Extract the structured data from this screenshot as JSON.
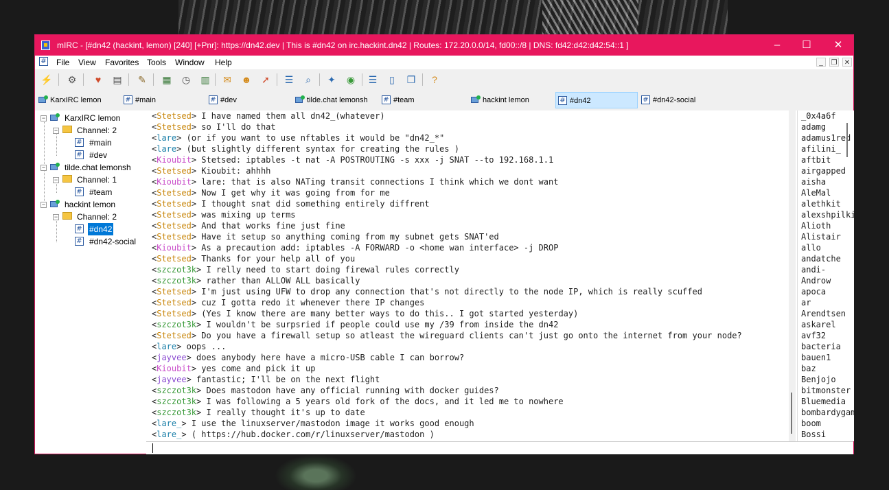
{
  "window": {
    "title": "mIRC - [#dn42 (hackint, lemon) [240] [+Pnr]: https://dn42.dev | This is #dn42 on irc.hackint.dn42 | Routes: 172.20.0.0/14, fd00::/8 | DNS: fd42:d42:d42:54::1 ]",
    "controls": {
      "minimize": "–",
      "maximize": "☐",
      "close": "✕"
    },
    "accent": "#e8175d"
  },
  "menu": {
    "items": [
      "File",
      "View",
      "Favorites",
      "Tools",
      "Window",
      "Help"
    ],
    "mdi_controls": {
      "minimize": "_",
      "restore": "❐",
      "close": "✕"
    }
  },
  "toolbar": {
    "icons": [
      "connect-icon",
      "options-icon",
      "favorites-icon",
      "address-book-icon",
      "scripts-editor-icon",
      "logs-icon",
      "dcc-icon",
      "timer-icon",
      "notify-list-icon",
      "url-list-icon",
      "channels-list-icon",
      "dcc-send-icon",
      "dcc-chat-icon",
      "received-files-icon",
      "highlights-icon",
      "tile-horizontal-icon",
      "tile-vertical-icon",
      "cascade-icon",
      "help-icon"
    ]
  },
  "switchbar": {
    "items": [
      {
        "label": "KarxIRC lemon",
        "type": "network"
      },
      {
        "label": "#main",
        "type": "channel"
      },
      {
        "label": "#dev",
        "type": "channel"
      },
      {
        "label": "tilde.chat lemonsh",
        "type": "network"
      },
      {
        "label": "#team",
        "type": "channel"
      },
      {
        "label": "hackint lemon",
        "type": "network"
      },
      {
        "label": "#dn42",
        "type": "channel",
        "active": true
      },
      {
        "label": "#dn42-social",
        "type": "channel"
      }
    ]
  },
  "tree": {
    "networks": [
      {
        "label": "KarxIRC lemon",
        "folder": "Channel: 2",
        "channels": [
          "#main",
          "#dev"
        ]
      },
      {
        "label": "tilde.chat lemonsh",
        "folder": "Channel: 1",
        "channels": [
          "#team"
        ]
      },
      {
        "label": "hackint lemon",
        "folder": "Channel: 2",
        "channels": [
          "#dn42",
          "#dn42-social"
        ]
      }
    ],
    "selected": "#dn42"
  },
  "nick_colors": {
    "Stetsed": "#c8860a",
    "lare": "#1a7fa8",
    "Kioubit": "#c94cc9",
    "szczot3k": "#3a9a3a",
    "jayvee": "#8a4ad0",
    "lare_": "#1a7fa8"
  },
  "messages": [
    {
      "nick": "Stetsed",
      "text": "I have named them all dn42_(whatever)"
    },
    {
      "nick": "Stetsed",
      "text": "so I'll do that"
    },
    {
      "nick": "lare",
      "text": "(or if you want to use nftables it would be \"dn42_*\""
    },
    {
      "nick": "lare",
      "text": "(but slightly different syntax for creating the rules )"
    },
    {
      "nick": "Kioubit",
      "text": "Stetsed: iptables -t nat -A POSTROUTING -s xxx -j SNAT --to 192.168.1.1"
    },
    {
      "nick": "Stetsed",
      "text": "Kioubit: ahhhh"
    },
    {
      "nick": "Kioubit",
      "text": "lare: that is also NATing transit connections I think which we dont want"
    },
    {
      "nick": "Stetsed",
      "text": "Now I get why it was going from for me"
    },
    {
      "nick": "Stetsed",
      "text": "I thought snat did something entirely diffrent"
    },
    {
      "nick": "Stetsed",
      "text": "was mixing up terms"
    },
    {
      "nick": "Stetsed",
      "text": "And that works fine just fine"
    },
    {
      "nick": "Stetsed",
      "text": "Have it setup so anything coming from my subnet gets SNAT'ed"
    },
    {
      "nick": "Kioubit",
      "text": "As a precaution add: iptables -A FORWARD -o <home wan interface> -j DROP"
    },
    {
      "nick": "Stetsed",
      "text": "Thanks for your help all of you"
    },
    {
      "nick": "szczot3k",
      "text": "I relly need to start doing firewal rules correctly"
    },
    {
      "nick": "szczot3k",
      "text": "rather than ALLOW ALL basically"
    },
    {
      "nick": "Stetsed",
      "text": "I'm just using UFW to drop any connection that's not directly to the node IP, which is really scuffed"
    },
    {
      "nick": "Stetsed",
      "text": "cuz I gotta redo it whenever there IP changes"
    },
    {
      "nick": "Stetsed",
      "text": "(Yes I know there are many better ways to do this.. I got started yesterday)"
    },
    {
      "nick": "szczot3k",
      "text": "I wouldn't be surpsried if people could use my /39 from inside the dn42"
    },
    {
      "nick": "Stetsed",
      "text": "Do you have a firewall setup so atleast the wireguard clients can't just go onto the internet from your node?"
    },
    {
      "nick": "lare",
      "text": "oops ..."
    },
    {
      "nick": "jayvee",
      "text": "does anybody here have a micro-USB cable I can borrow?"
    },
    {
      "nick": "Kioubit",
      "text": "yes come and pick it up"
    },
    {
      "nick": "jayvee",
      "text": "fantastic; I'll be on the next flight"
    },
    {
      "nick": "szczot3k",
      "text": "Does mastodon have any official running with docker guides?"
    },
    {
      "nick": "szczot3k",
      "text": "I was following a 5 years old fork of the docs, and it led me to nowhere"
    },
    {
      "nick": "szczot3k",
      "text": "I really thought it's up to date"
    },
    {
      "nick": "lare_",
      "text": "I use the linuxserver/mastodon image it works good enough"
    },
    {
      "nick": "lare_",
      "text": "( https://hub.docker.com/r/linuxserver/mastodon )"
    }
  ],
  "nicklist": [
    "_0x4a6f",
    "adamg",
    "adamus1red",
    "afilini_",
    "aftbit",
    "airgapped",
    "aisha",
    "AleMal",
    "alethkit",
    "alexshpilkin",
    "Alioth",
    "Alistair",
    "allo",
    "andatche",
    "andi-",
    "Androw",
    "apoca",
    "ar",
    "Arendtsen",
    "askarel",
    "avf32",
    "bacteria",
    "bauen1",
    "baz",
    "Benjojo",
    "bitmonster",
    "Bluemedia",
    "bombardygamer",
    "boom",
    "Bossi"
  ],
  "editbox": {
    "value": ""
  }
}
